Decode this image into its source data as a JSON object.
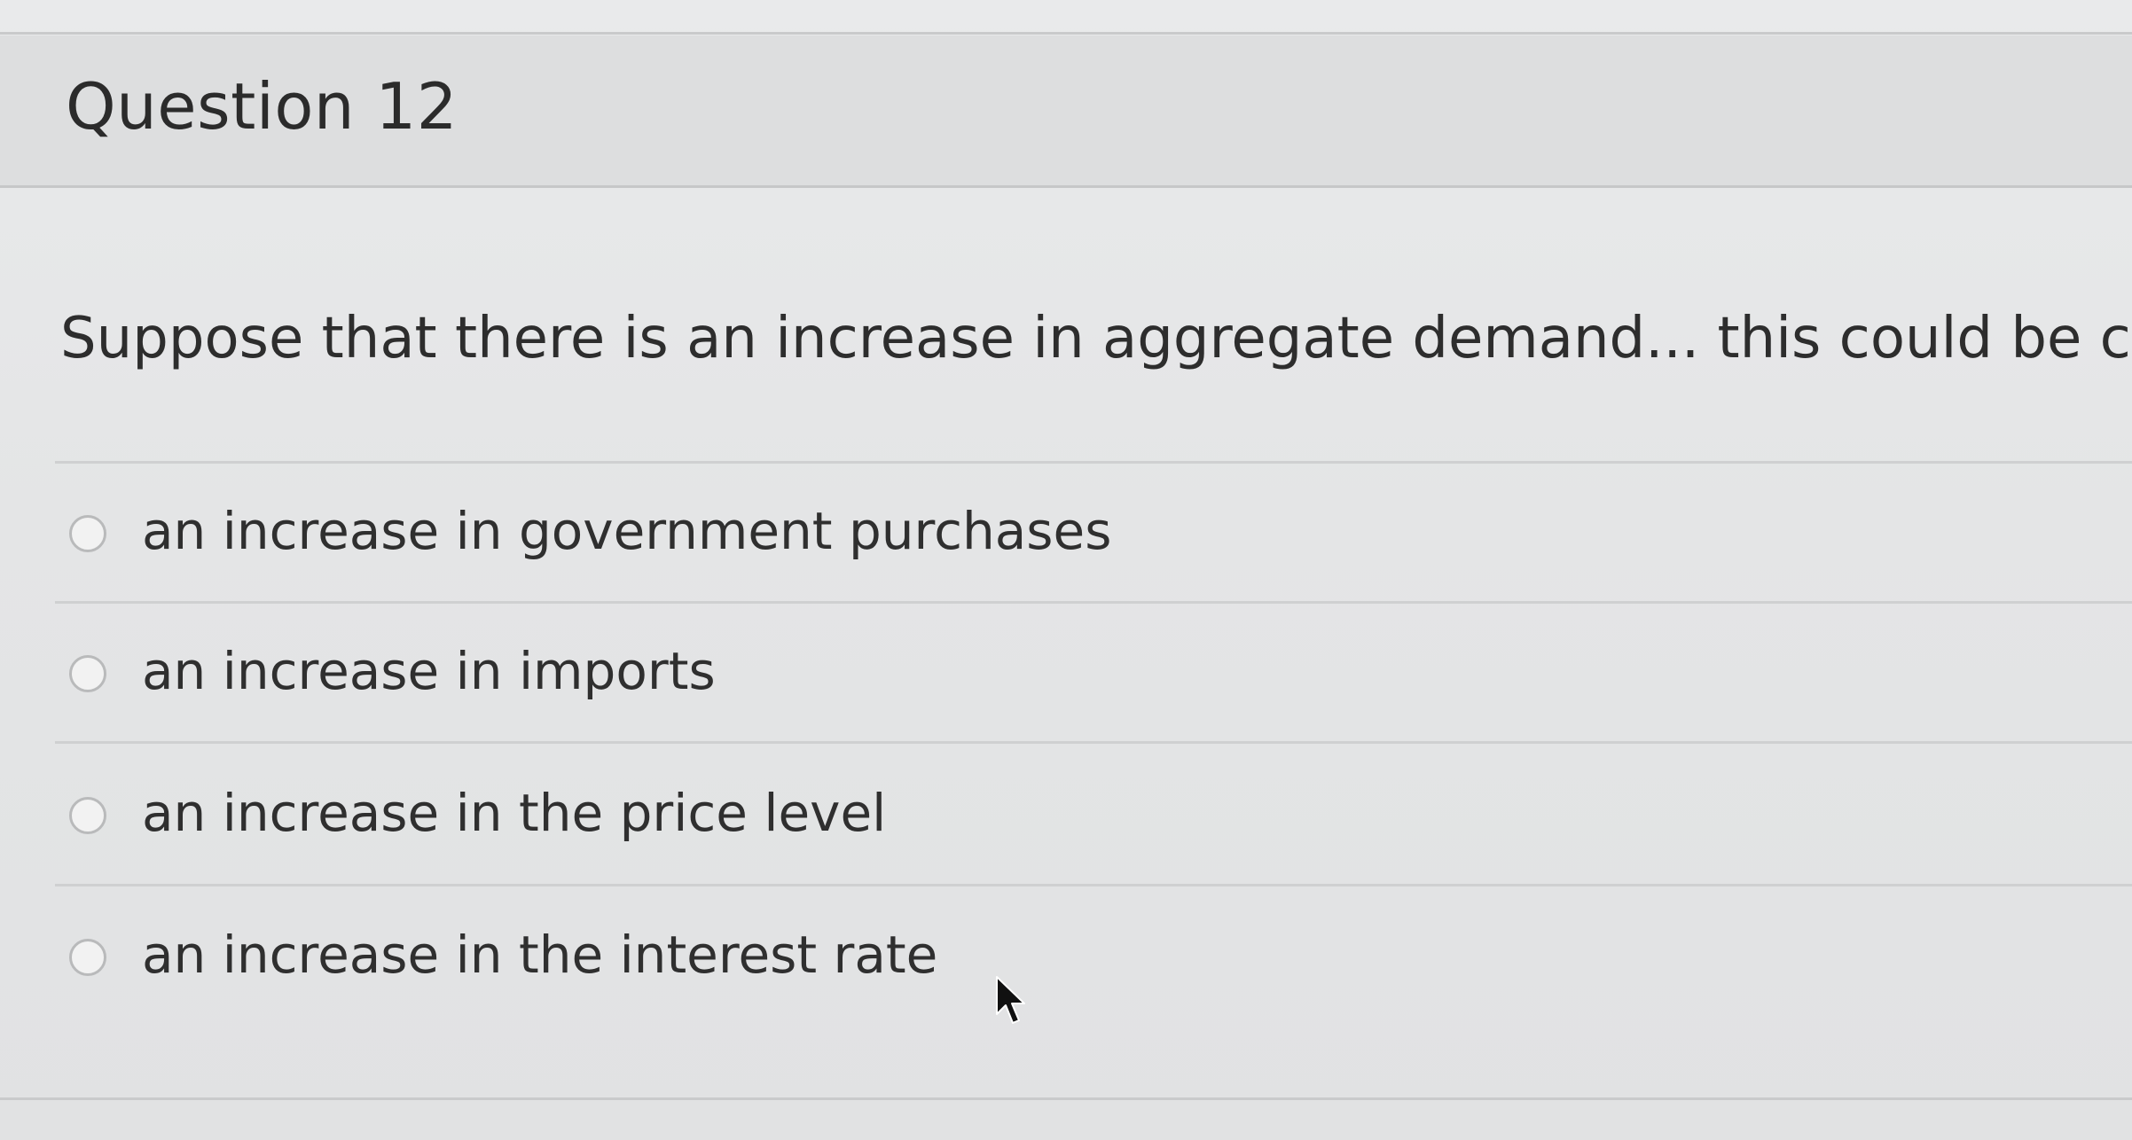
{
  "question": {
    "title": "Question 12",
    "text": "Suppose that there is an increase in aggregate demand... this could be caused by",
    "answers": [
      {
        "label": "an increase in government purchases"
      },
      {
        "label": "an increase in imports"
      },
      {
        "label": "an increase in the price level"
      },
      {
        "label": "an increase in the interest rate"
      }
    ]
  },
  "icons": {
    "cursor": "mouse-pointer-icon"
  }
}
